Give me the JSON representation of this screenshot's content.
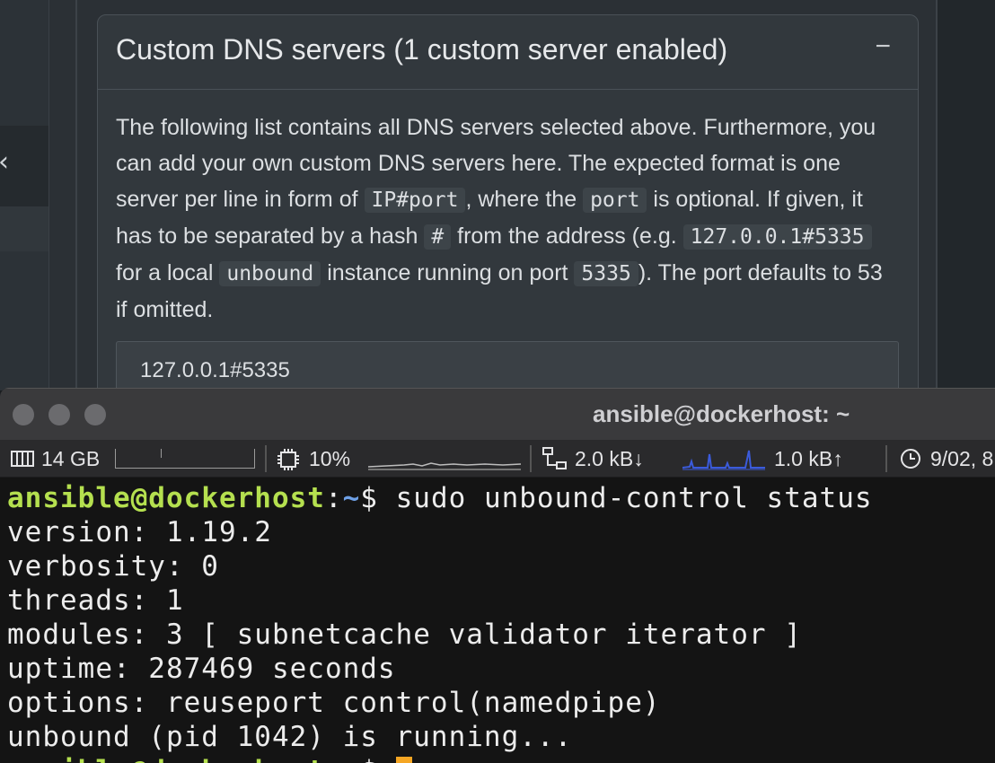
{
  "browser": {
    "sidebar_collapse_glyph": "‹",
    "card": {
      "title": "Custom DNS servers (1 custom server enabled)",
      "collapse_glyph": "−",
      "desc": {
        "p1": "The following list contains all DNS servers selected above. Furthermore, you can add your own custom DNS servers here. The expected format is one server per line in form of ",
        "code1": "IP#port",
        "p2": ", where the ",
        "code2": "port",
        "p3": " is optional. If given, it has to be separated by a hash ",
        "code3": "#",
        "p4": " from the address (e.g. ",
        "code4": "127.0.0.1#5335",
        "p5": " for a local ",
        "code5": "unbound",
        "p6": " instance running on port ",
        "code6": "5335",
        "p7": "). The port defaults to 53 if omitted."
      },
      "textarea_value": "127.0.0.1#5335"
    }
  },
  "terminal": {
    "title": "ansible@dockerhost: ~",
    "statusbar": {
      "memory": "14 GB",
      "cpu": "10%",
      "net_down": "2.0 kB↓",
      "net_up": "1.0 kB↑",
      "date": "9/02, 8"
    },
    "prompt_user": "ansible@dockerhost",
    "prompt_sep": ":",
    "prompt_path": "~",
    "prompt_end": "$ ",
    "command": "sudo unbound-control status",
    "output": [
      "version: 1.19.2",
      "verbosity: 0",
      "threads: 1",
      "modules: 3 [ subnetcache validator iterator ]",
      "uptime: 287469 seconds",
      "options: reuseport control(namedpipe)",
      "unbound (pid 1042) is running..."
    ],
    "colors": {
      "user": "#b5e04f",
      "path": "#6ea0e6",
      "cursor": "#f5a623"
    }
  }
}
